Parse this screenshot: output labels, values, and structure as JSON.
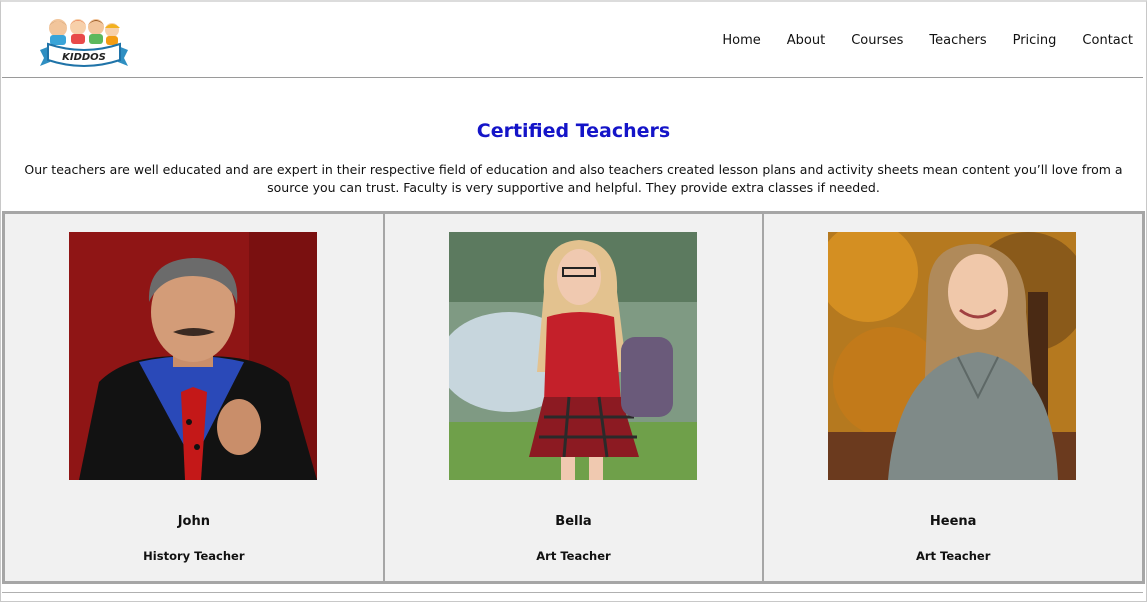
{
  "header": {
    "logo_text": "KIDDOS",
    "nav": [
      "Home",
      "About",
      "Courses",
      "Teachers",
      "Pricing",
      "Contact"
    ]
  },
  "section": {
    "title": "Certified Teachers",
    "intro": "Our teachers are well educated and are expert in their respective field of education and also teachers created lesson plans and activity sheets mean content you’ll love from a source you can trust. Faculty is very supportive and helpful. They provide extra classes if needed."
  },
  "teachers": [
    {
      "name": "John",
      "role": "History Teacher"
    },
    {
      "name": "Bella",
      "role": "Art Teacher"
    },
    {
      "name": "Heena",
      "role": "Art Teacher"
    }
  ],
  "colors": {
    "title": "#1414c8",
    "card_bg": "#f1f1f1",
    "card_border": "#a6a6a6"
  }
}
